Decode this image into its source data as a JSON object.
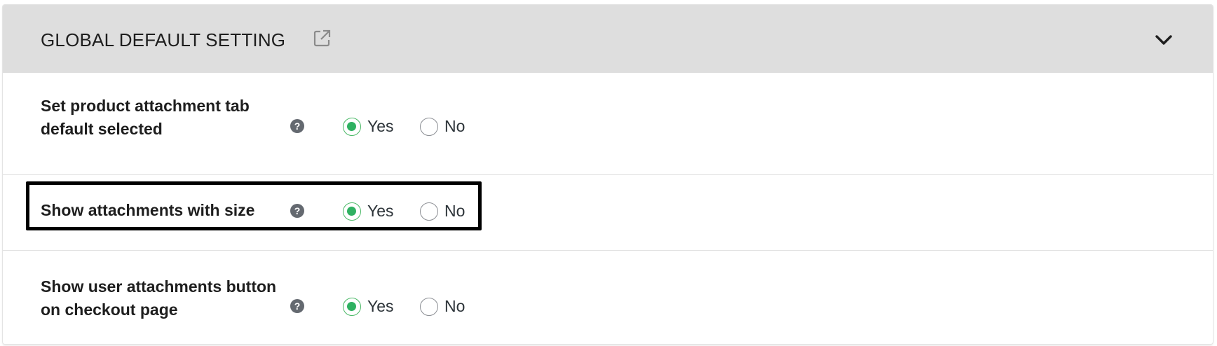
{
  "panel": {
    "title": "GLOBAL DEFAULT SETTING",
    "external_link_icon": "external-link-icon",
    "collapse_icon": "chevron-down-icon"
  },
  "settings": [
    {
      "label": "Set product attachment tab default selected",
      "help_icon": "question-icon",
      "help_glyph": "?",
      "options": [
        {
          "label": "Yes",
          "checked": true
        },
        {
          "label": "No",
          "checked": false
        }
      ]
    },
    {
      "label": "Show attachments with size",
      "help_icon": "question-icon",
      "help_glyph": "?",
      "options": [
        {
          "label": "Yes",
          "checked": true
        },
        {
          "label": "No",
          "checked": false
        }
      ]
    },
    {
      "label": "Show user attachments button on checkout page",
      "help_icon": "question-icon",
      "help_glyph": "?",
      "options": [
        {
          "label": "Yes",
          "checked": true
        },
        {
          "label": "No",
          "checked": false
        }
      ]
    }
  ],
  "colors": {
    "header_bg": "#dedede",
    "radio_checked": "#2fb161",
    "help_icon_bg": "#646970",
    "highlight_border": "#000000"
  }
}
